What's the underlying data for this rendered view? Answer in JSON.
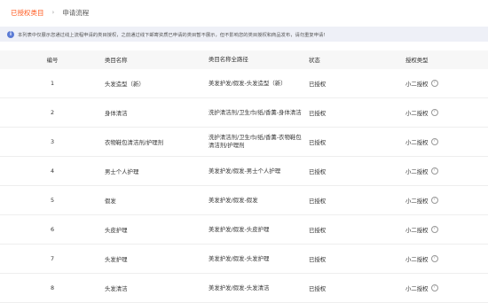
{
  "breadcrumb": {
    "active": "已授权类目",
    "separator": "›",
    "current": "申请流程"
  },
  "notice": {
    "icon": "info-icon",
    "text": "本列表中仅展示您通过线上流程申请的类目授权，之前通过线下邮寄资质已申请的类目暂不展示，但不影响您的类目授权和商品发布，请勿重复申请!"
  },
  "table": {
    "headers": {
      "index": "编号",
      "name": "类目名称",
      "path": "类目名称全路径",
      "status": "状态",
      "type": "授权类型"
    },
    "rows": [
      {
        "index": "1",
        "name": "头发造型（新）",
        "path": "美发护发/假发-头发造型（新）",
        "status": "已授权",
        "type": "小二授权"
      },
      {
        "index": "2",
        "name": "身体清洁",
        "path": "洗护清洁剂/卫生巾/纸/香薰-身体清洁",
        "status": "已授权",
        "type": "小二授权"
      },
      {
        "index": "3",
        "name": "衣物鞋包清洁剂/护理剂",
        "path": "洗护清洁剂/卫生巾/纸/香薰-衣物鞋包清洁剂/护理剂",
        "status": "已授权",
        "type": "小二授权"
      },
      {
        "index": "4",
        "name": "男士个人护理",
        "path": "美发护发/假发-男士个人护理",
        "status": "已授权",
        "type": "小二授权"
      },
      {
        "index": "5",
        "name": "假发",
        "path": "美发护发/假发-假发",
        "status": "已授权",
        "type": "小二授权"
      },
      {
        "index": "6",
        "name": "头皮护理",
        "path": "美发护发/假发-头皮护理",
        "status": "已授权",
        "type": "小二授权"
      },
      {
        "index": "7",
        "name": "头发护理",
        "path": "美发护发/假发-头发护理",
        "status": "已授权",
        "type": "小二授权"
      },
      {
        "index": "8",
        "name": "头发清洁",
        "path": "美发护发/假发-头发清洁",
        "status": "已授权",
        "type": "小二授权"
      }
    ]
  },
  "colors": {
    "accent": "#ff5a1f",
    "info": "#5b7bd5",
    "notice_bg": "#eef0f7",
    "header_bg": "#f7f7f7"
  }
}
